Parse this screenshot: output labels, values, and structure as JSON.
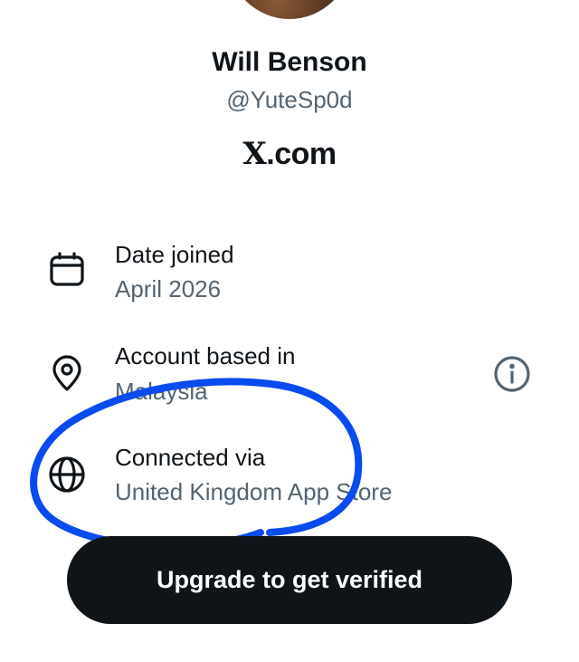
{
  "profile": {
    "name": "Will Benson",
    "handle": "@YuteSp0d",
    "brand_mark": "X",
    "brand_suffix": ".com"
  },
  "rows": [
    {
      "icon": "calendar-icon",
      "title": "Date joined",
      "value": "April 2026"
    },
    {
      "icon": "location-pin-icon",
      "title": "Account based in",
      "value": "Malaysia"
    },
    {
      "icon": "globe-icon",
      "title": "Connected via",
      "value": "United Kingdom App Store"
    }
  ],
  "info_icon": "info-icon",
  "cta": {
    "label": "Upgrade to get verified"
  },
  "colors": {
    "primary_text": "#0f1419",
    "secondary_text": "#536471",
    "button_bg": "#0f1419",
    "annotation": "#0a4bf0"
  }
}
